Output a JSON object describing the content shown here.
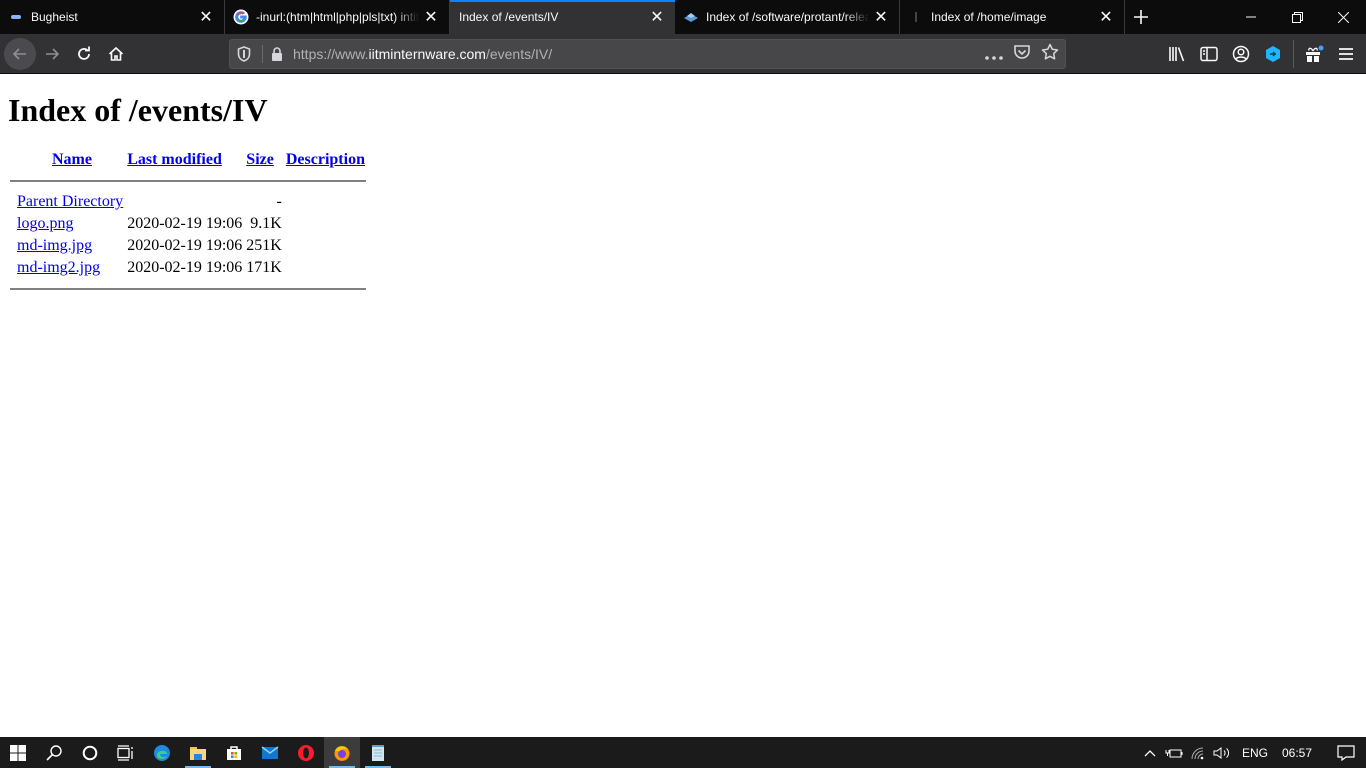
{
  "browser": {
    "tabs": [
      {
        "title": "Bugheist",
        "favicon": "bugheist-icon",
        "active": false
      },
      {
        "title": "-inurl:(htm|html|php|pls|txt) intitle:index.of",
        "favicon": "google-icon",
        "active": false
      },
      {
        "title": "Index of /events/IV",
        "favicon": "none",
        "active": true
      },
      {
        "title": "Index of /software/protant/releases",
        "favicon": "disk-icon",
        "active": false
      },
      {
        "title": "Index of /home/image",
        "favicon": "generic-icon",
        "active": false
      }
    ],
    "new_tab_label": "+",
    "url": {
      "scheme": "https://www.",
      "host": "iitminternware.com",
      "path": "/events/IV/"
    },
    "colors": {
      "accent": "#0a84ff",
      "tabstrip": "#0c0c0d",
      "toolbar": "#323234"
    }
  },
  "page": {
    "title": "Index of /events/IV",
    "columns": {
      "name": "Name",
      "last_modified": "Last modified",
      "size": "Size",
      "description": "Description"
    },
    "parent": {
      "name": "Parent Directory",
      "modified": "",
      "size": "-",
      "description": ""
    },
    "rows": [
      {
        "name": "logo.png",
        "modified": "2020-02-19 19:06",
        "size": "9.1K",
        "description": ""
      },
      {
        "name": "md-img.jpg",
        "modified": "2020-02-19 19:06",
        "size": "251K",
        "description": ""
      },
      {
        "name": "md-img2.jpg",
        "modified": "2020-02-19 19:06",
        "size": "171K",
        "description": ""
      }
    ]
  },
  "taskbar": {
    "apps": [
      "start",
      "search",
      "cortana",
      "task-view",
      "edge",
      "file-explorer",
      "store",
      "mail",
      "opera",
      "firefox",
      "notepad"
    ],
    "tray": {
      "language": "ENG",
      "time": "06:57"
    }
  }
}
